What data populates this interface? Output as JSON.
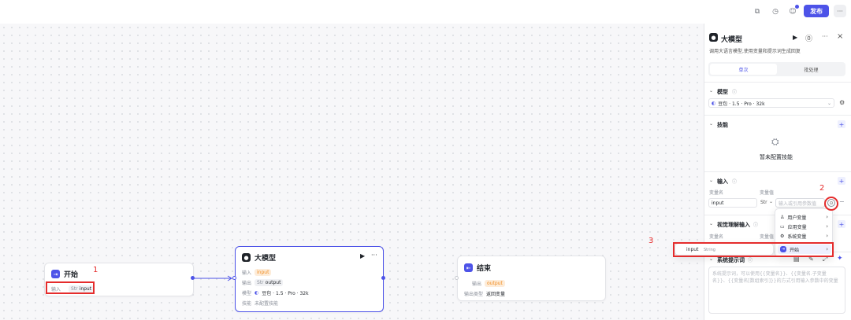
{
  "topbar": {
    "publish_label": "发布",
    "more_label": "···"
  },
  "annotations": {
    "one": "1",
    "two": "2",
    "three": "3"
  },
  "start_node": {
    "title": "开始",
    "input_label": "输入",
    "type_chip": "Str",
    "param": "input"
  },
  "llm_node": {
    "title": "大模型",
    "input_label": "输入",
    "input_value": "input",
    "output_label": "输出",
    "output_type": "Str",
    "output_value": "output",
    "model_label": "模型",
    "model_value": "豆包 · 1.5 · Pro · 32k",
    "skill_label": "技能",
    "skill_value": "未配置技能"
  },
  "end_node": {
    "title": "结束",
    "output_label": "输出",
    "output_value": "output",
    "output_type_label": "输出类型",
    "output_type_value": "返回变量"
  },
  "panel": {
    "title": "大模型",
    "subtitle": "调用大语言模型,使用变量和提示词生成回复",
    "tab_single": "单次",
    "tab_batch": "批处理",
    "model_section": "模型",
    "model_value": "豆包 · 1.5 · Pro · 32k",
    "skill_section": "技能",
    "skill_empty": "暂未配置技能",
    "input_section": "输入",
    "col_name": "变量名",
    "col_value": "变量值",
    "input_name": "input",
    "input_type": "Str",
    "input_placeholder": "输入或引用参数值",
    "vision_section": "视觉理解输入",
    "vision_col_name": "变量名",
    "vision_col_value": "变量值",
    "system_prompt_section": "系统提示词",
    "system_prompt_placeholder": "系统提示词，可以使用{{变量名}}、{{变量名.子变量名}}、{{变量名[数组索引]}}的方式引用输入参数中的变量"
  },
  "var_menu": {
    "items": [
      {
        "label": "用户变量",
        "icon": "user-icon"
      },
      {
        "label": "应用变量",
        "icon": "app-icon"
      },
      {
        "label": "系统变量",
        "icon": "gear-icon"
      },
      {
        "label": "开始",
        "icon": "start-icon"
      }
    ]
  },
  "sub_menu": {
    "name": "input",
    "type": "String"
  },
  "colors": {
    "accent": "#4d53e8",
    "annotation_red": "#e52c2c",
    "chip_orange": "#f08b1e"
  }
}
